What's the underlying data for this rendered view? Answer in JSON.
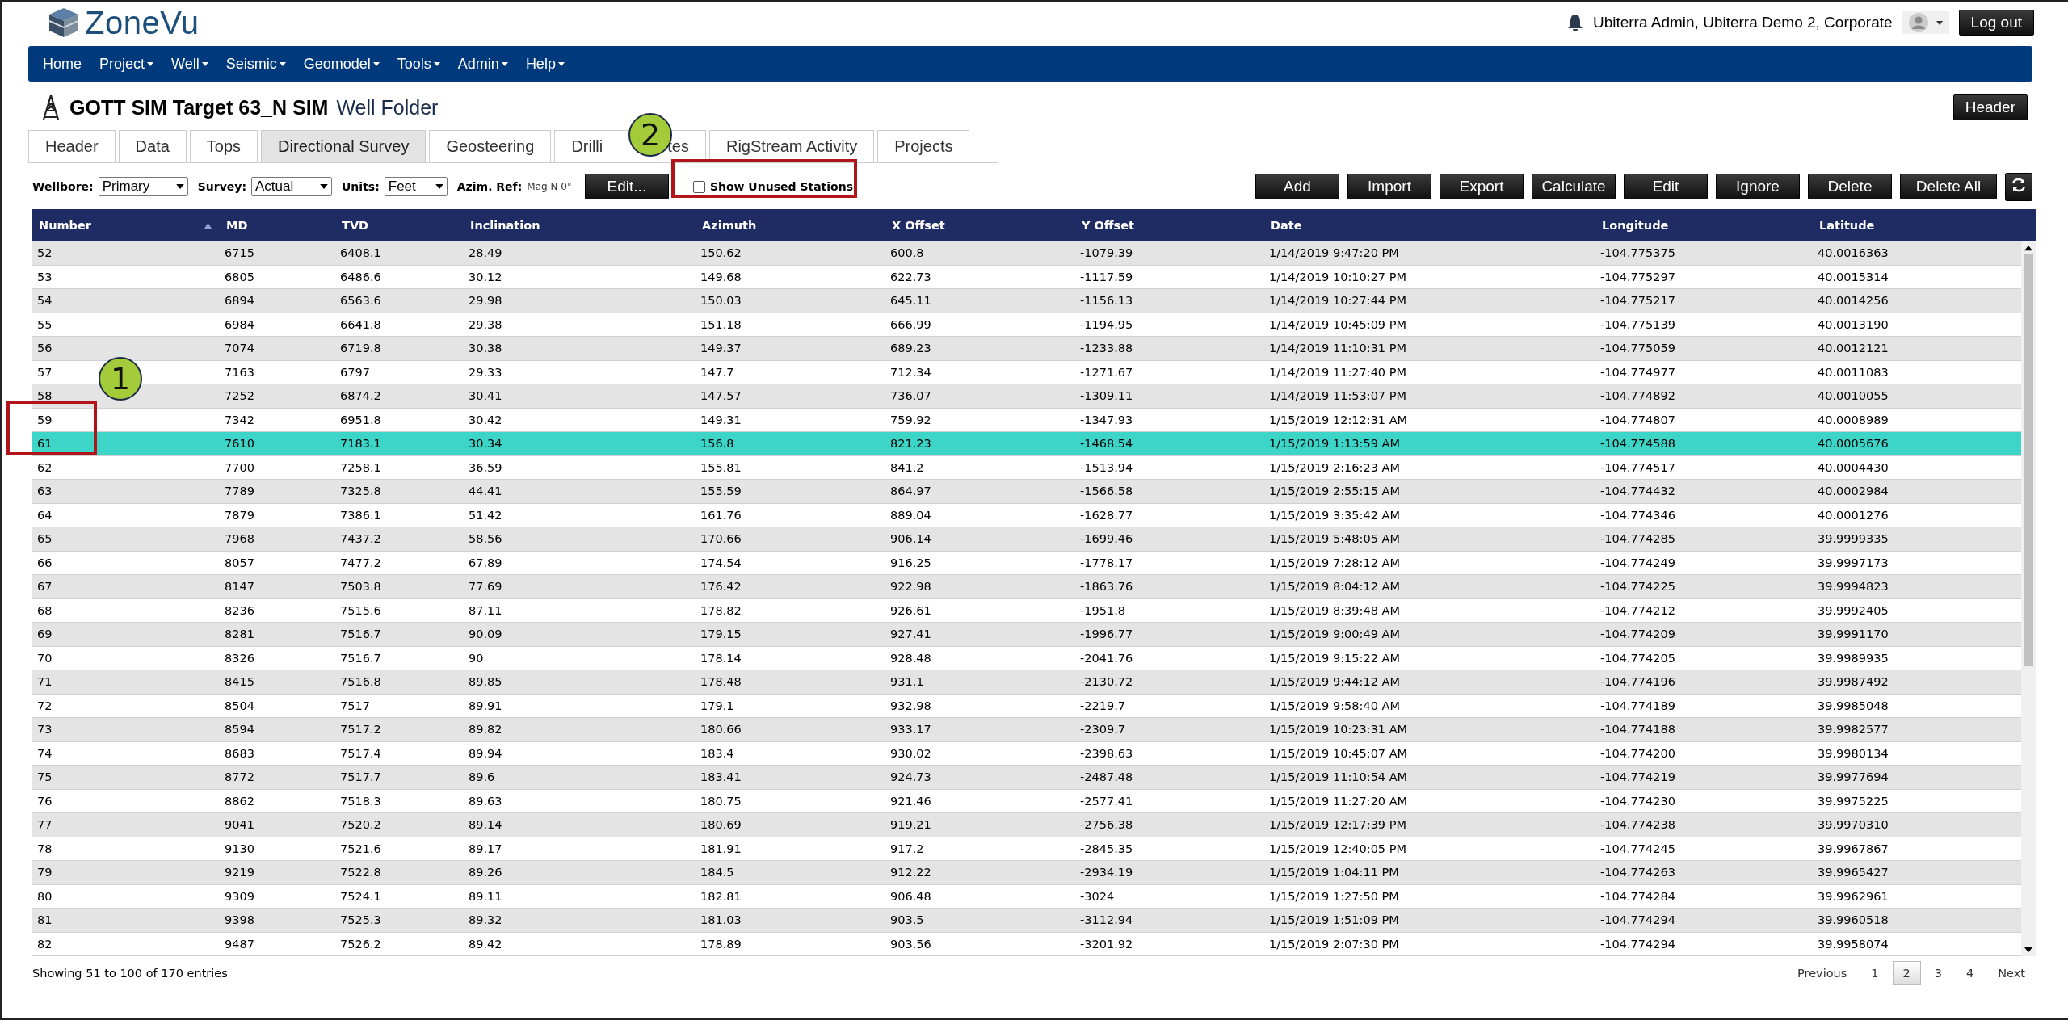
{
  "brand": {
    "name": "ZoneVu"
  },
  "user": {
    "text": "Ubiterra Admin, Ubiterra Demo 2, Corporate",
    "logout": "Log out"
  },
  "nav": [
    {
      "label": "Home",
      "dropdown": false
    },
    {
      "label": "Project",
      "dropdown": true
    },
    {
      "label": "Well",
      "dropdown": true
    },
    {
      "label": "Seismic",
      "dropdown": true
    },
    {
      "label": "Geomodel",
      "dropdown": true
    },
    {
      "label": "Tools",
      "dropdown": true
    },
    {
      "label": "Admin",
      "dropdown": true
    },
    {
      "label": "Help",
      "dropdown": true
    }
  ],
  "page_title": {
    "name": "GOTT SIM Target 63_N SIM",
    "subtitle": "Well Folder",
    "button": "Header"
  },
  "tabs": [
    {
      "label": "Header",
      "selected": false
    },
    {
      "label": "Data",
      "selected": false
    },
    {
      "label": "Tops",
      "selected": false
    },
    {
      "label": "Directional Survey",
      "selected": true
    },
    {
      "label": "Geosteering",
      "selected": false
    },
    {
      "label": "Drilli",
      "label_end": "tes",
      "selected": false
    },
    {
      "label": "RigStream Activity",
      "selected": false
    },
    {
      "label": "Projects",
      "selected": false
    }
  ],
  "toolbar": {
    "selects": [
      {
        "label": "Wellbore:",
        "value": "Primary"
      },
      {
        "label": "Survey:",
        "value": "Actual"
      },
      {
        "label": "Units:",
        "value": "Feet"
      }
    ],
    "azim_label": "Azim. Ref:",
    "azim_value": "Mag N 0°",
    "edit_button": "Edit...",
    "show_unused": {
      "label": "Show Unused Stations",
      "checked": false
    },
    "buttons": [
      "Add",
      "Import",
      "Export",
      "Calculate",
      "Edit",
      "Ignore",
      "Delete",
      "Delete All"
    ]
  },
  "table": {
    "columns": [
      "Number",
      "MD",
      "TVD",
      "Inclination",
      "Azimuth",
      "X Offset",
      "Y Offset",
      "Date",
      "Longitude",
      "Latitude"
    ],
    "rows": [
      {
        "cells": [
          "52",
          "6715",
          "6408.1",
          "28.49",
          "150.62",
          "600.8",
          "-1079.39",
          "1/14/2019 9:47:20 PM",
          "-104.775375",
          "40.0016363"
        ],
        "selected": false
      },
      {
        "cells": [
          "53",
          "6805",
          "6486.6",
          "30.12",
          "149.68",
          "622.73",
          "-1117.59",
          "1/14/2019 10:10:27 PM",
          "-104.775297",
          "40.0015314"
        ],
        "selected": false
      },
      {
        "cells": [
          "54",
          "6894",
          "6563.6",
          "29.98",
          "150.03",
          "645.11",
          "-1156.13",
          "1/14/2019 10:27:44 PM",
          "-104.775217",
          "40.0014256"
        ],
        "selected": false
      },
      {
        "cells": [
          "55",
          "6984",
          "6641.8",
          "29.38",
          "151.18",
          "666.99",
          "-1194.95",
          "1/14/2019 10:45:09 PM",
          "-104.775139",
          "40.0013190"
        ],
        "selected": false
      },
      {
        "cells": [
          "56",
          "7074",
          "6719.8",
          "30.38",
          "149.37",
          "689.23",
          "-1233.88",
          "1/14/2019 11:10:31 PM",
          "-104.775059",
          "40.0012121"
        ],
        "selected": false
      },
      {
        "cells": [
          "57",
          "7163",
          "6797",
          "29.33",
          "147.7",
          "712.34",
          "-1271.67",
          "1/14/2019 11:27:40 PM",
          "-104.774977",
          "40.0011083"
        ],
        "selected": false
      },
      {
        "cells": [
          "58",
          "7252",
          "6874.2",
          "30.41",
          "147.57",
          "736.07",
          "-1309.11",
          "1/14/2019 11:53:07 PM",
          "-104.774892",
          "40.0010055"
        ],
        "selected": false
      },
      {
        "cells": [
          "59",
          "7342",
          "6951.8",
          "30.42",
          "149.31",
          "759.92",
          "-1347.93",
          "1/15/2019 12:12:31 AM",
          "-104.774807",
          "40.0008989"
        ],
        "selected": false
      },
      {
        "cells": [
          "61",
          "7610",
          "7183.1",
          "30.34",
          "156.8",
          "821.23",
          "-1468.54",
          "1/15/2019 1:13:59 AM",
          "-104.774588",
          "40.0005676"
        ],
        "selected": true
      },
      {
        "cells": [
          "62",
          "7700",
          "7258.1",
          "36.59",
          "155.81",
          "841.2",
          "-1513.94",
          "1/15/2019 2:16:23 AM",
          "-104.774517",
          "40.0004430"
        ],
        "selected": false
      },
      {
        "cells": [
          "63",
          "7789",
          "7325.8",
          "44.41",
          "155.59",
          "864.97",
          "-1566.58",
          "1/15/2019 2:55:15 AM",
          "-104.774432",
          "40.0002984"
        ],
        "selected": false
      },
      {
        "cells": [
          "64",
          "7879",
          "7386.1",
          "51.42",
          "161.76",
          "889.04",
          "-1628.77",
          "1/15/2019 3:35:42 AM",
          "-104.774346",
          "40.0001276"
        ],
        "selected": false
      },
      {
        "cells": [
          "65",
          "7968",
          "7437.2",
          "58.56",
          "170.66",
          "906.14",
          "-1699.46",
          "1/15/2019 5:48:05 AM",
          "-104.774285",
          "39.9999335"
        ],
        "selected": false
      },
      {
        "cells": [
          "66",
          "8057",
          "7477.2",
          "67.89",
          "174.54",
          "916.25",
          "-1778.17",
          "1/15/2019 7:28:12 AM",
          "-104.774249",
          "39.9997173"
        ],
        "selected": false
      },
      {
        "cells": [
          "67",
          "8147",
          "7503.8",
          "77.69",
          "176.42",
          "922.98",
          "-1863.76",
          "1/15/2019 8:04:12 AM",
          "-104.774225",
          "39.9994823"
        ],
        "selected": false
      },
      {
        "cells": [
          "68",
          "8236",
          "7515.6",
          "87.11",
          "178.82",
          "926.61",
          "-1951.8",
          "1/15/2019 8:39:48 AM",
          "-104.774212",
          "39.9992405"
        ],
        "selected": false
      },
      {
        "cells": [
          "69",
          "8281",
          "7516.7",
          "90.09",
          "179.15",
          "927.41",
          "-1996.77",
          "1/15/2019 9:00:49 AM",
          "-104.774209",
          "39.9991170"
        ],
        "selected": false
      },
      {
        "cells": [
          "70",
          "8326",
          "7516.7",
          "90",
          "178.14",
          "928.48",
          "-2041.76",
          "1/15/2019 9:15:22 AM",
          "-104.774205",
          "39.9989935"
        ],
        "selected": false
      },
      {
        "cells": [
          "71",
          "8415",
          "7516.8",
          "89.85",
          "178.48",
          "931.1",
          "-2130.72",
          "1/15/2019 9:44:12 AM",
          "-104.774196",
          "39.9987492"
        ],
        "selected": false
      },
      {
        "cells": [
          "72",
          "8504",
          "7517",
          "89.91",
          "179.1",
          "932.98",
          "-2219.7",
          "1/15/2019 9:58:40 AM",
          "-104.774189",
          "39.9985048"
        ],
        "selected": false
      },
      {
        "cells": [
          "73",
          "8594",
          "7517.2",
          "89.82",
          "180.66",
          "933.17",
          "-2309.7",
          "1/15/2019 10:23:31 AM",
          "-104.774188",
          "39.9982577"
        ],
        "selected": false
      },
      {
        "cells": [
          "74",
          "8683",
          "7517.4",
          "89.94",
          "183.4",
          "930.02",
          "-2398.63",
          "1/15/2019 10:45:07 AM",
          "-104.774200",
          "39.9980134"
        ],
        "selected": false
      },
      {
        "cells": [
          "75",
          "8772",
          "7517.7",
          "89.6",
          "183.41",
          "924.73",
          "-2487.48",
          "1/15/2019 11:10:54 AM",
          "-104.774219",
          "39.9977694"
        ],
        "selected": false
      },
      {
        "cells": [
          "76",
          "8862",
          "7518.3",
          "89.63",
          "180.75",
          "921.46",
          "-2577.41",
          "1/15/2019 11:27:20 AM",
          "-104.774230",
          "39.9975225"
        ],
        "selected": false
      },
      {
        "cells": [
          "77",
          "9041",
          "7520.2",
          "89.14",
          "180.69",
          "919.21",
          "-2756.38",
          "1/15/2019 12:17:39 PM",
          "-104.774238",
          "39.9970310"
        ],
        "selected": false
      },
      {
        "cells": [
          "78",
          "9130",
          "7521.6",
          "89.17",
          "181.91",
          "917.2",
          "-2845.35",
          "1/15/2019 12:40:05 PM",
          "-104.774245",
          "39.9967867"
        ],
        "selected": false
      },
      {
        "cells": [
          "79",
          "9219",
          "7522.8",
          "89.26",
          "184.5",
          "912.22",
          "-2934.19",
          "1/15/2019 1:04:11 PM",
          "-104.774263",
          "39.9965427"
        ],
        "selected": false
      },
      {
        "cells": [
          "80",
          "9309",
          "7524.1",
          "89.11",
          "182.81",
          "906.48",
          "-3024",
          "1/15/2019 1:27:50 PM",
          "-104.774284",
          "39.9962961"
        ],
        "selected": false
      },
      {
        "cells": [
          "81",
          "9398",
          "7525.3",
          "89.32",
          "181.03",
          "903.5",
          "-3112.94",
          "1/15/2019 1:51:09 PM",
          "-104.774294",
          "39.9960518"
        ],
        "selected": false
      },
      {
        "cells": [
          "82",
          "9487",
          "7526.2",
          "89.42",
          "178.89",
          "903.56",
          "-3201.92",
          "1/15/2019 2:07:30 PM",
          "-104.774294",
          "39.9958074"
        ],
        "selected": false
      }
    ]
  },
  "footer": {
    "info": "Showing 51 to 100 of 170 entries",
    "pages": [
      {
        "label": "Previous",
        "selected": false
      },
      {
        "label": "1",
        "selected": false
      },
      {
        "label": "2",
        "selected": true
      },
      {
        "label": "3",
        "selected": false
      },
      {
        "label": "4",
        "selected": false
      },
      {
        "label": "Next",
        "selected": false
      }
    ]
  },
  "callouts": [
    {
      "label": "1"
    },
    {
      "label": "2"
    }
  ]
}
